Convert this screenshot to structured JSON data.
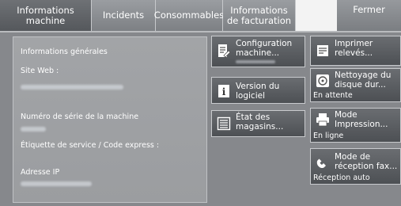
{
  "tabs": [
    {
      "label": "Informations\nmachine",
      "active": true
    },
    {
      "label": "Incidents"
    },
    {
      "label": "Consommables"
    },
    {
      "label": "Informations\nde facturation"
    },
    {
      "label": ""
    },
    {
      "label": "Fermer"
    }
  ],
  "info": {
    "heading": "Informations générales",
    "site_web_label": "Site Web :",
    "serial_label": "Numéro de série de la machine",
    "service_tag_label": "Étiquette de service / Code express :",
    "ip_label": "Adresse IP"
  },
  "buttons": {
    "config": {
      "label": "Configuration\nmachine...",
      "icon": "config-icon"
    },
    "version": {
      "label": "Version du\nlogiciel",
      "icon": "info-icon"
    },
    "magasins": {
      "label": "État des\nmagasins...",
      "icon": "list-icon"
    },
    "imprimer": {
      "label": "Imprimer\nrelevés...",
      "icon": "report-icon"
    },
    "nettoyage": {
      "label": "Nettoyage du\ndisque dur...",
      "status": "En attente",
      "icon": "disk-icon"
    },
    "impression": {
      "label": "Mode\nImpression...",
      "status": "En ligne",
      "icon": "printer-icon"
    },
    "fax": {
      "label": "Mode de\nréception fax...",
      "status": "Réception auto",
      "icon": "phone-icon"
    }
  }
}
